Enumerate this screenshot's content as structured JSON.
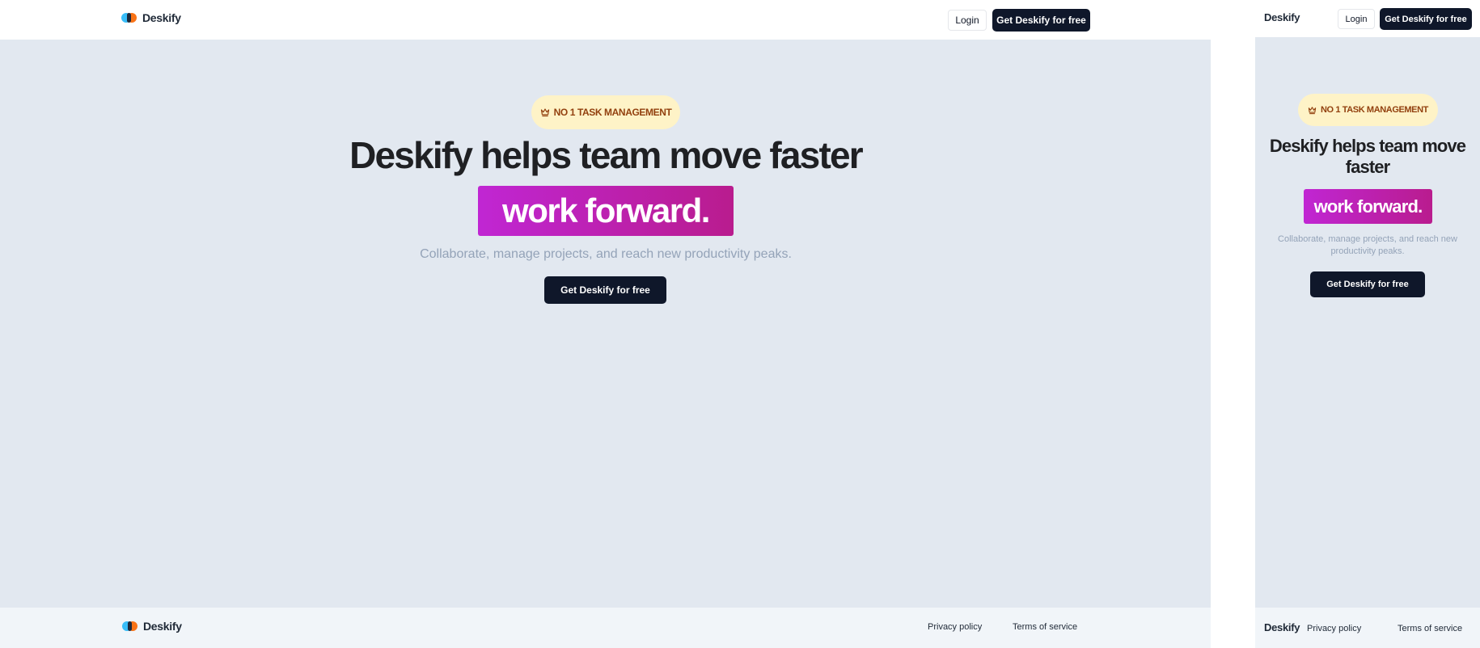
{
  "brand": {
    "name": "Deskify"
  },
  "nav": {
    "login_label": "Login",
    "cta_label": "Get Deskify for free"
  },
  "hero": {
    "badge": "NO 1 TASK MANAGEMENT",
    "badge_icon": "crown-icon",
    "title": "Deskify helps team move faster",
    "highlight": "work forward.",
    "subtitle": "Collaborate, manage projects, and reach new productivity peaks.",
    "cta_label": "Get Deskify for free"
  },
  "footer": {
    "privacy_label": "Privacy policy",
    "terms_label": "Terms of service"
  },
  "colors": {
    "page_bg": "#e2e8f0",
    "header_bg": "#ffffff",
    "footer_bg": "#f1f5f9",
    "dark_button": "#0f172a",
    "badge_bg": "#fef3c7",
    "badge_text": "#92400e",
    "highlight_start": "#c026d3",
    "highlight_end": "#b91c8e"
  }
}
